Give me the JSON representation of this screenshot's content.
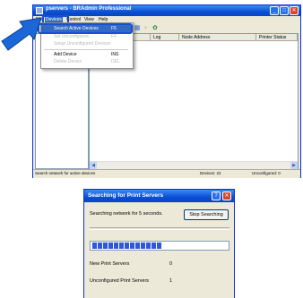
{
  "main_window": {
    "title": "pservers - BRAdmin Professional",
    "controls": [
      "_",
      "□",
      "✕"
    ],
    "menu": [
      "File",
      "Devices",
      "Control",
      "View",
      "Help"
    ],
    "toolbar_icons": [
      "new-icon",
      "open-icon",
      "save-icon",
      "print-icon",
      "refresh-icon",
      "properties-icon",
      "key-icon",
      "network-icon"
    ],
    "columns": [
      "Log",
      "Node Address",
      "Printer Status"
    ],
    "status_left": "Search network for active devices",
    "status_devices": "Devices: 22",
    "status_unconfigured": "Unconfigured: 0"
  },
  "devices_menu": {
    "items": [
      {
        "label": "Search Active Devices",
        "shortcut": "F5",
        "state": "selected"
      },
      {
        "label": "Set Unconfigured...",
        "shortcut": "F4",
        "state": "disabled"
      },
      {
        "label": "Setup Unconfigured Devices",
        "shortcut": "",
        "state": "disabled"
      },
      {
        "label": "Add Device",
        "shortcut": "INS",
        "state": "normal"
      },
      {
        "label": "Delete Device",
        "shortcut": "DEL",
        "state": "disabled"
      }
    ]
  },
  "dialog": {
    "title": "Searching for Print Servers",
    "message": "Searching network for 5 seconds.",
    "stop_button": "Stop Searching",
    "progress_segments": 13,
    "new_label": "New Print Servers",
    "new_count": "0",
    "unconfigured_label": "Unconfigured Print Servers",
    "unconfigured_count": "1"
  },
  "colors": {
    "xp_title_blue": "#0a4fd4",
    "highlight_blue": "#1a4fd6",
    "selection_blue": "#316ac5",
    "progress_blue": "#2f58d6"
  }
}
